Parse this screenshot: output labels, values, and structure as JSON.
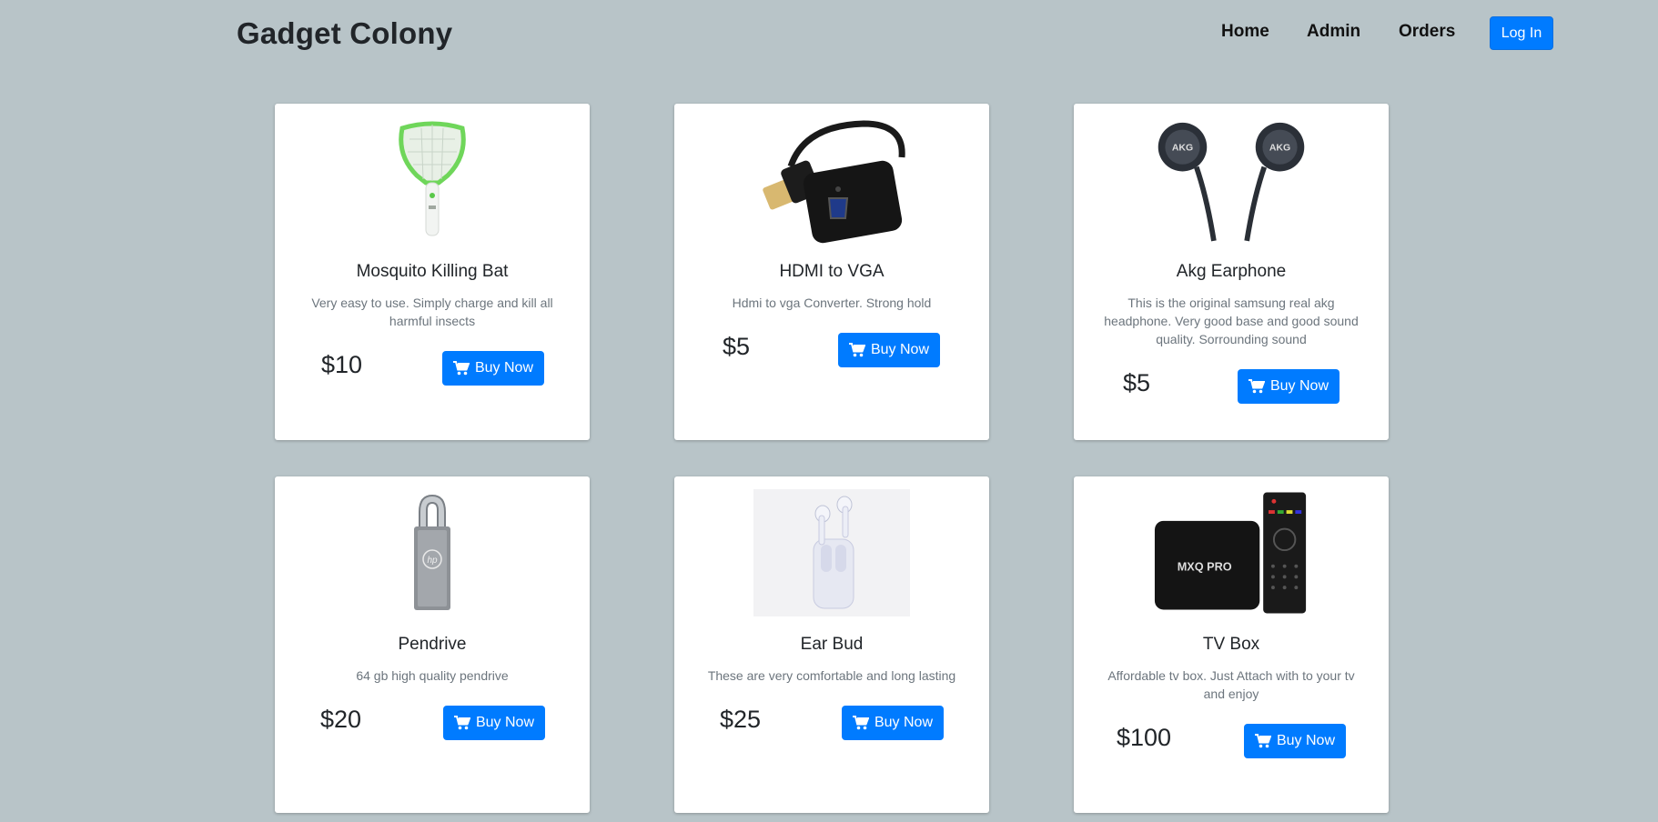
{
  "header": {
    "brand": "Gadget Colony",
    "nav": [
      "Home",
      "Admin",
      "Orders"
    ],
    "login_label": "Log In"
  },
  "colors": {
    "background": "#b8c4c8",
    "accent": "#007bff",
    "card": "#ffffff"
  },
  "products": [
    {
      "title": "Mosquito Killing Bat",
      "description": "Very easy to use. Simply charge and kill all harmful insects",
      "price": "$10",
      "buy_label": "Buy Now",
      "icon": "mosquito-bat-icon"
    },
    {
      "title": "HDMI to VGA",
      "description": "Hdmi to vga Converter. Strong hold",
      "price": "$5",
      "buy_label": "Buy Now",
      "icon": "hdmi-vga-adapter-icon"
    },
    {
      "title": "Akg Earphone",
      "description": "This is the original samsung real akg headphone. Very good base and good sound quality. Sorrounding sound",
      "price": "$5",
      "buy_label": "Buy Now",
      "icon": "earphone-icon"
    },
    {
      "title": "Pendrive",
      "description": "64 gb high quality pendrive",
      "price": "$20",
      "buy_label": "Buy Now",
      "icon": "pendrive-icon"
    },
    {
      "title": "Ear Bud",
      "description": "These are very comfortable and long lasting",
      "price": "$25",
      "buy_label": "Buy Now",
      "icon": "earbuds-icon"
    },
    {
      "title": "TV Box",
      "description": "Affordable tv box. Just Attach with to your tv and enjoy",
      "price": "$100",
      "buy_label": "Buy Now",
      "icon": "tv-box-icon"
    }
  ]
}
